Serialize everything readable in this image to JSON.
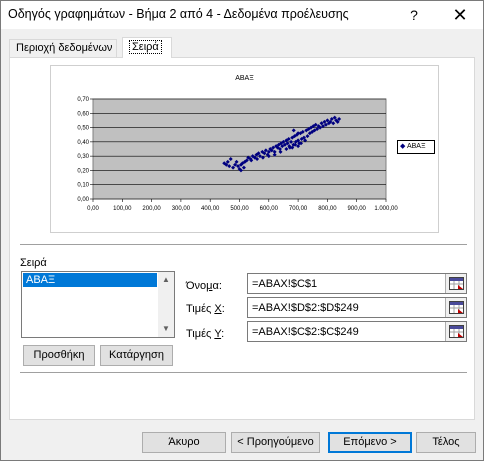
{
  "window": {
    "title": "Οδηγός γραφημάτων - Βήμα 2 από 4 - Δεδομένα προέλευσης",
    "help": "?",
    "close": "✕"
  },
  "tabs": [
    {
      "label": "Περιοχή δεδομένων"
    },
    {
      "label": "Σειρά"
    }
  ],
  "chart_data": {
    "type": "scatter",
    "title": "ABAΞ",
    "xlabel": "",
    "ylabel": "",
    "xlim": [
      0,
      1000
    ],
    "ylim": [
      0,
      0.7
    ],
    "x_ticks": [
      "0,00",
      "100,00",
      "200,00",
      "300,00",
      "400,00",
      "500,00",
      "600,00",
      "700,00",
      "800,00",
      "900,00",
      "1.000,00"
    ],
    "y_ticks": [
      "0,00",
      "0,10",
      "0,20",
      "0,30",
      "0,40",
      "0,50",
      "0,60",
      "0,70"
    ],
    "grid": true,
    "legend_position": "right",
    "series": [
      {
        "name": "ABAΞ",
        "color": "#000080",
        "points": [
          [
            448,
            0.25
          ],
          [
            455,
            0.24
          ],
          [
            460,
            0.26
          ],
          [
            465,
            0.23
          ],
          [
            470,
            0.28
          ],
          [
            478,
            0.22
          ],
          [
            485,
            0.24
          ],
          [
            490,
            0.26
          ],
          [
            495,
            0.23
          ],
          [
            500,
            0.21
          ],
          [
            505,
            0.24
          ],
          [
            510,
            0.25
          ],
          [
            518,
            0.26
          ],
          [
            525,
            0.27
          ],
          [
            530,
            0.29
          ],
          [
            538,
            0.28
          ],
          [
            545,
            0.3
          ],
          [
            552,
            0.29
          ],
          [
            558,
            0.31
          ],
          [
            565,
            0.32
          ],
          [
            570,
            0.3
          ],
          [
            578,
            0.33
          ],
          [
            585,
            0.32
          ],
          [
            590,
            0.34
          ],
          [
            596,
            0.31
          ],
          [
            600,
            0.33
          ],
          [
            605,
            0.35
          ],
          [
            610,
            0.34
          ],
          [
            615,
            0.36
          ],
          [
            620,
            0.33
          ],
          [
            625,
            0.37
          ],
          [
            630,
            0.36
          ],
          [
            634,
            0.38
          ],
          [
            638,
            0.35
          ],
          [
            642,
            0.39
          ],
          [
            646,
            0.37
          ],
          [
            650,
            0.4
          ],
          [
            655,
            0.38
          ],
          [
            660,
            0.41
          ],
          [
            664,
            0.39
          ],
          [
            668,
            0.42
          ],
          [
            672,
            0.36
          ],
          [
            676,
            0.4
          ],
          [
            680,
            0.43
          ],
          [
            684,
            0.38
          ],
          [
            688,
            0.44
          ],
          [
            692,
            0.4
          ],
          [
            696,
            0.45
          ],
          [
            700,
            0.41
          ],
          [
            704,
            0.39
          ],
          [
            708,
            0.46
          ],
          [
            712,
            0.42
          ],
          [
            716,
            0.47
          ],
          [
            720,
            0.43
          ],
          [
            724,
            0.41
          ],
          [
            728,
            0.48
          ],
          [
            732,
            0.44
          ],
          [
            736,
            0.49
          ],
          [
            740,
            0.46
          ],
          [
            744,
            0.5
          ],
          [
            748,
            0.47
          ],
          [
            752,
            0.51
          ],
          [
            756,
            0.48
          ],
          [
            760,
            0.52
          ],
          [
            765,
            0.49
          ],
          [
            770,
            0.51
          ],
          [
            775,
            0.5
          ],
          [
            780,
            0.53
          ],
          [
            785,
            0.51
          ],
          [
            790,
            0.54
          ],
          [
            795,
            0.52
          ],
          [
            800,
            0.55
          ],
          [
            805,
            0.53
          ],
          [
            810,
            0.54
          ],
          [
            815,
            0.56
          ],
          [
            820,
            0.53
          ],
          [
            825,
            0.57
          ],
          [
            830,
            0.55
          ],
          [
            835,
            0.54
          ],
          [
            840,
            0.56
          ],
          [
            660,
            0.35
          ],
          [
            670,
            0.37
          ],
          [
            680,
            0.36
          ],
          [
            690,
            0.38
          ],
          [
            700,
            0.37
          ],
          [
            710,
            0.39
          ],
          [
            685,
            0.48
          ],
          [
            700,
            0.46
          ],
          [
            640,
            0.33
          ],
          [
            620,
            0.31
          ],
          [
            600,
            0.3
          ],
          [
            580,
            0.29
          ],
          [
            560,
            0.28
          ],
          [
            540,
            0.27
          ],
          [
            515,
            0.22
          ],
          [
            505,
            0.2
          ]
        ]
      }
    ]
  },
  "series_section": {
    "label": "Σειρά",
    "items": [
      "ABAΞ"
    ],
    "add_button": "Προσθήκη",
    "remove_button": "Κατάργηση"
  },
  "fields": {
    "name_label_pre": "Όνο",
    "name_label_key": "μ",
    "name_label_post": "α:",
    "name_value": "=ABAX!$C$1",
    "x_label_pre": "Τιμές ",
    "x_label_key": "X",
    "x_label_post": ":",
    "x_value": "=ABAX!$D$2:$D$249",
    "y_label_pre": "Τιμές ",
    "y_label_key": "Y",
    "y_label_post": ":",
    "y_value": "=ABAX!$C$2:$C$249"
  },
  "footer": {
    "cancel": "Άκυρο",
    "back": "< Προηγούμενο",
    "next": "Επόμενο >",
    "finish": "Τέλος"
  }
}
